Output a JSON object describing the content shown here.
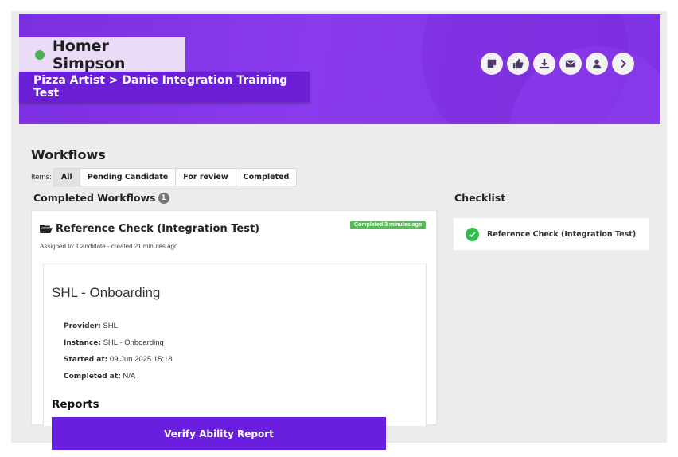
{
  "colors": {
    "brand": "#7a2fe0",
    "role_bg": "#6a1fd6",
    "status_online": "#4cb050",
    "completed_badge": "#5cb85c",
    "check": "#2fbf4a"
  },
  "candidate": {
    "name": "Homer Simpson",
    "role": "Pizza Artist > Danie Integration Training Test"
  },
  "header_actions": [
    {
      "icon": "note-icon"
    },
    {
      "icon": "thumbs-up-icon"
    },
    {
      "icon": "download-icon"
    },
    {
      "icon": "email-icon"
    },
    {
      "icon": "user-icon"
    },
    {
      "icon": "chevron-right-icon"
    }
  ],
  "workflows": {
    "title": "Workflows",
    "items_label": "Items:",
    "tabs": [
      {
        "label": "All",
        "active": true
      },
      {
        "label": "Pending Candidate"
      },
      {
        "label": "For review"
      },
      {
        "label": "Completed"
      }
    ],
    "completed_title": "Completed Workflows",
    "completed_count": "1"
  },
  "workflow_card": {
    "title": "Reference Check (Integration Test)",
    "badge": "Completed 3 minutes ago",
    "subtitle": "Assigned to: Candidate - created 21 minutes ago",
    "inner": {
      "title": "SHL - Onboarding",
      "provider_label": "Provider:",
      "provider_value": "SHL",
      "instance_label": "Instance:",
      "instance_value": "SHL - Onboarding",
      "started_label": "Started at:",
      "started_value": "09 Jun 2025 15:18",
      "completed_label": "Completed at:",
      "completed_value": "N/A"
    }
  },
  "checklist": {
    "title": "Checklist",
    "items": [
      {
        "label": "Reference Check (Integration Test)",
        "done": true
      }
    ]
  },
  "reports": {
    "title": "Reports",
    "button_label": "Verify Ability Report"
  }
}
